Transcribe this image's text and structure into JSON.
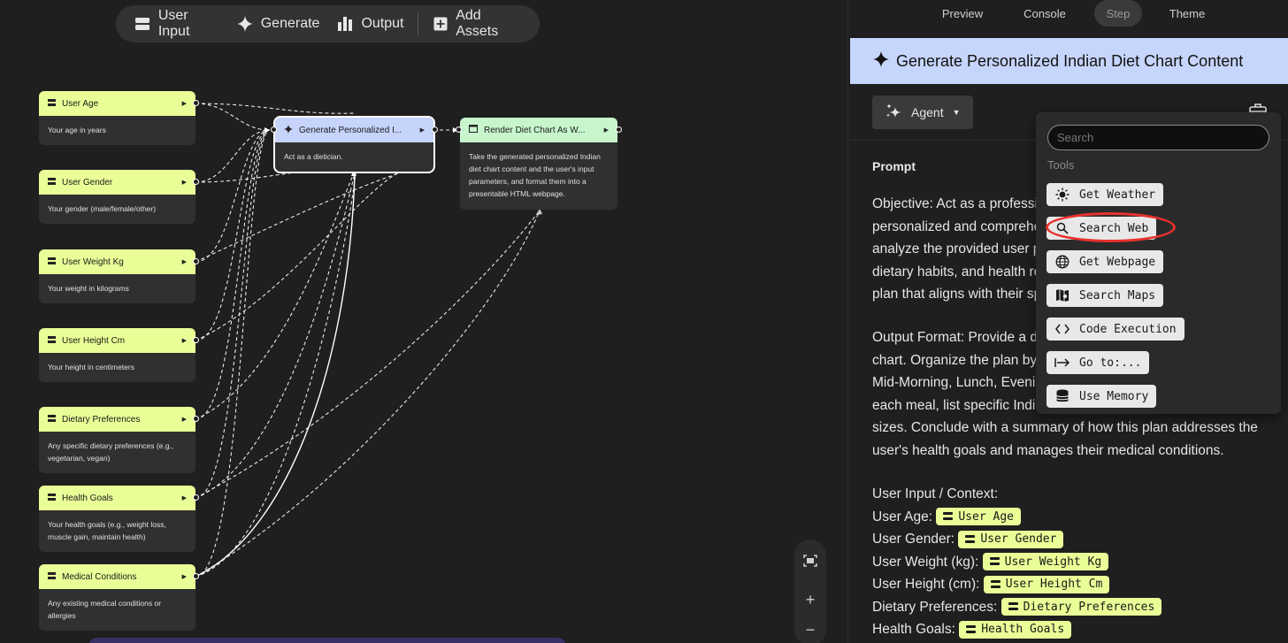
{
  "toolbar": {
    "user_input": "User Input",
    "generate": "Generate",
    "output": "Output",
    "add_assets": "Add Assets"
  },
  "nodes": {
    "user_age": {
      "title": "User Age",
      "desc": "Your age in years"
    },
    "user_gender": {
      "title": "User Gender",
      "desc": "Your gender (male/female/other)"
    },
    "user_weight": {
      "title": "User Weight Kg",
      "desc": "Your weight in kilograms"
    },
    "user_height": {
      "title": "User Height Cm",
      "desc": "Your height in centimeters"
    },
    "dietary": {
      "title": "Dietary Preferences",
      "desc": "Any specific dietary preferences (e.g., vegetarian, vegan)"
    },
    "health_goals": {
      "title": "Health Goals",
      "desc": "Your health goals (e.g., weight loss, muscle gain, maintain health)"
    },
    "medical": {
      "title": "Medical Conditions",
      "desc": "Any existing medical conditions or allergies"
    },
    "generate": {
      "title": "Generate Personalized I...",
      "desc": "Act as a dietician."
    },
    "render": {
      "title": "Render Diet Chart As W...",
      "desc": "Take the generated personalized Indian diet chart content and the user's input parameters, and format them into a presentable HTML webpage."
    }
  },
  "tabs": [
    "Preview",
    "Console",
    "Step",
    "Theme"
  ],
  "panel": {
    "title": "Generate Personalized Indian Diet Chart Content",
    "agent_label": "Agent",
    "prompt_label": "Prompt",
    "p1_lines": [
      "Objective: Act as a professi",
      "personalized and comprehe",
      "analyze the provided user p",
      "dietary habits, and health re",
      "plan that aligns with their sp"
    ],
    "p2_lines": [
      "Output Format: Provide a de",
      "chart. Organize the plan by",
      "Mid-Morning, Lunch, Evenin",
      "each meal, list specific India",
      "sizes. Conclude with a summary of how this plan addresses the",
      "user's health goals and manages their medical conditions."
    ],
    "context_heading": "User Input / Context:",
    "context": [
      {
        "label": "User Age:",
        "chip": "User Age"
      },
      {
        "label": "User Gender:",
        "chip": "User Gender"
      },
      {
        "label": "User Weight (kg):",
        "chip": "User Weight Kg"
      },
      {
        "label": "User Height (cm):",
        "chip": "User Height Cm"
      },
      {
        "label": "Dietary Preferences:",
        "chip": "Dietary Preferences"
      },
      {
        "label": "Health Goals:",
        "chip": "Health Goals"
      }
    ]
  },
  "tools_popup": {
    "search_placeholder": "Search",
    "section_label": "Tools",
    "items": [
      "Get Weather",
      "Search Web",
      "Get Webpage",
      "Search Maps",
      "Code Execution",
      "Go to:...",
      "Use Memory"
    ]
  }
}
